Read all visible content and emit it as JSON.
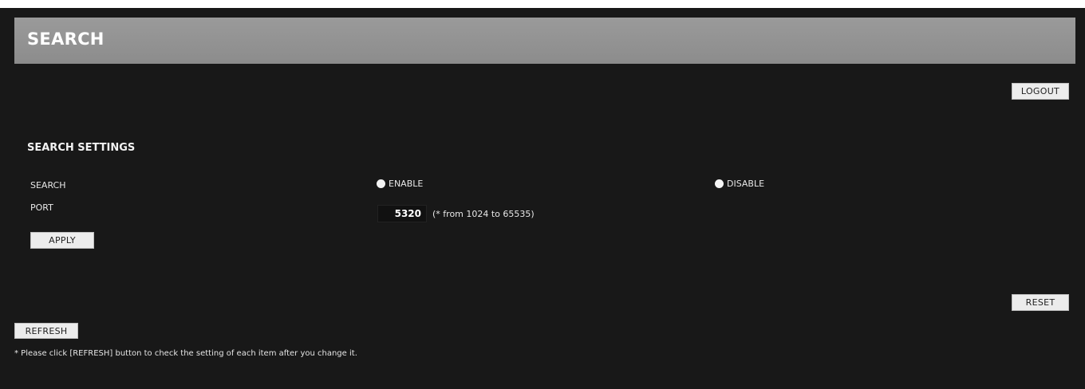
{
  "header": {
    "title": "SEARCH"
  },
  "toolbar": {
    "logout_label": "LOGOUT",
    "reset_label": "RESET",
    "refresh_label": "REFRESH"
  },
  "settings": {
    "section_title": "SEARCH SETTINGS",
    "search": {
      "label": "SEARCH",
      "options": [
        "ENABLE",
        "DISABLE"
      ],
      "selected": "ENABLE"
    },
    "port": {
      "label": "PORT",
      "value": "5320",
      "hint": "(* from 1024 to 65535)"
    },
    "apply_label": "APPLY"
  },
  "footer": {
    "note": "* Please click [REFRESH] button to check the setting of each item after you change it."
  },
  "colors": {
    "background": "#181818",
    "header": "#929292",
    "button": "#ececec"
  }
}
